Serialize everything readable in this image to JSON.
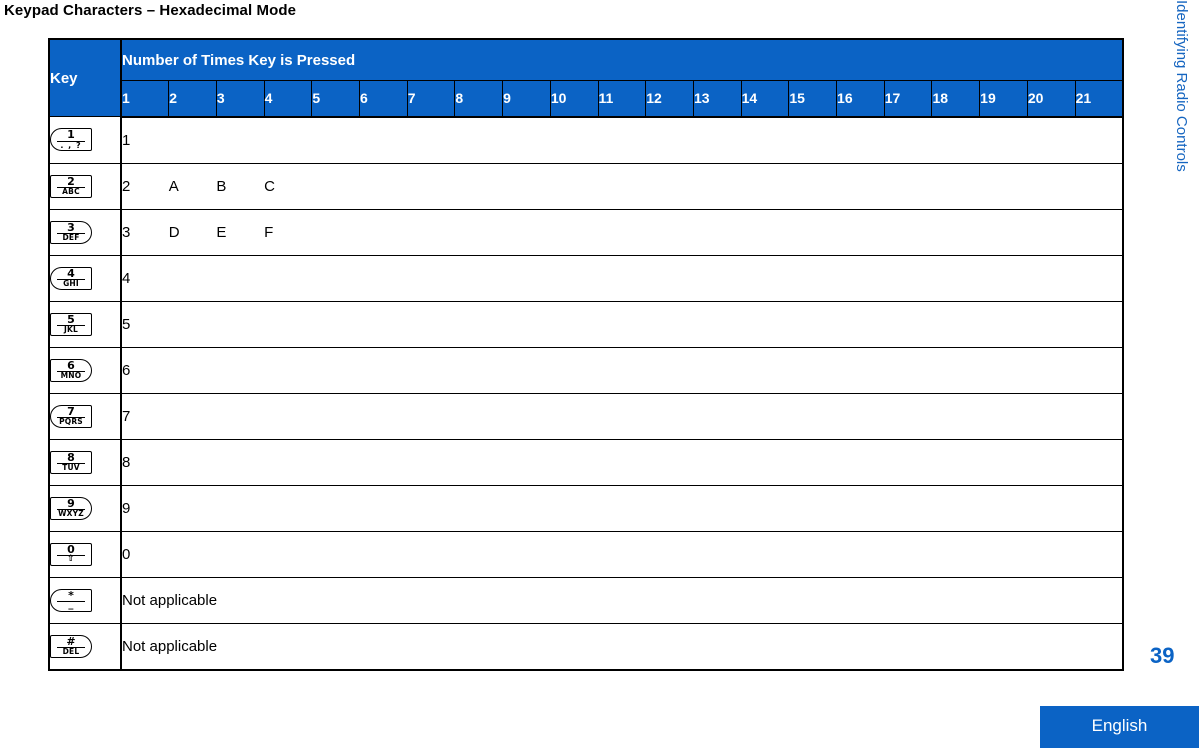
{
  "page_title": "Keypad Characters – Hexadecimal Mode",
  "sidebar": {
    "label": "Identifying Radio Controls"
  },
  "footer": {
    "page_number": "39",
    "language": "English"
  },
  "table": {
    "key_column_header": "Key",
    "press_column_header": "Number of Times Key is Pressed",
    "press_counts": [
      "1",
      "2",
      "3",
      "4",
      "5",
      "6",
      "7",
      "8",
      "9",
      "10",
      "11",
      "12",
      "13",
      "14",
      "15",
      "16",
      "17",
      "18",
      "19",
      "20",
      "21"
    ],
    "rows": [
      {
        "key_icon": "keypad-key-1",
        "key_digit": "1",
        "key_letters": ". , ?",
        "key_shape": "rounded-left",
        "values": [
          "1"
        ],
        "note": ""
      },
      {
        "key_icon": "keypad-key-2",
        "key_digit": "2",
        "key_letters": "ABC",
        "key_shape": "square",
        "values": [
          "2",
          "A",
          "B",
          "C"
        ],
        "note": ""
      },
      {
        "key_icon": "keypad-key-3",
        "key_digit": "3",
        "key_letters": "DEF",
        "key_shape": "rounded-right",
        "values": [
          "3",
          "D",
          "E",
          "F"
        ],
        "note": ""
      },
      {
        "key_icon": "keypad-key-4",
        "key_digit": "4",
        "key_letters": "GHI",
        "key_shape": "rounded-left",
        "values": [
          "4"
        ],
        "note": ""
      },
      {
        "key_icon": "keypad-key-5",
        "key_digit": "5",
        "key_letters": "JKL",
        "key_shape": "square",
        "values": [
          "5"
        ],
        "note": ""
      },
      {
        "key_icon": "keypad-key-6",
        "key_digit": "6",
        "key_letters": "MNO",
        "key_shape": "rounded-right",
        "values": [
          "6"
        ],
        "note": ""
      },
      {
        "key_icon": "keypad-key-7",
        "key_digit": "7",
        "key_letters": "PQRS",
        "key_shape": "rounded-left",
        "values": [
          "7"
        ],
        "note": ""
      },
      {
        "key_icon": "keypad-key-8",
        "key_digit": "8",
        "key_letters": "TUV",
        "key_shape": "square",
        "values": [
          "8"
        ],
        "note": ""
      },
      {
        "key_icon": "keypad-key-9",
        "key_digit": "9",
        "key_letters": "WXYZ",
        "key_shape": "rounded-right",
        "values": [
          "9"
        ],
        "note": ""
      },
      {
        "key_icon": "keypad-key-0",
        "key_digit": "0",
        "key_letters": "⇧",
        "key_shape": "square",
        "values": [
          "0"
        ],
        "note": ""
      },
      {
        "key_icon": "keypad-key-star",
        "key_digit": "*",
        "key_letters": "_",
        "key_shape": "rounded-left",
        "values": [],
        "note": "Not applicable"
      },
      {
        "key_icon": "keypad-key-hash",
        "key_digit": "#",
        "key_letters": "DEL",
        "key_shape": "rounded-right",
        "values": [],
        "note": "Not applicable"
      }
    ]
  },
  "colors": {
    "header_blue": "#0B63C5",
    "sidebar_blue": "#1565C0",
    "text_black": "#000000"
  }
}
